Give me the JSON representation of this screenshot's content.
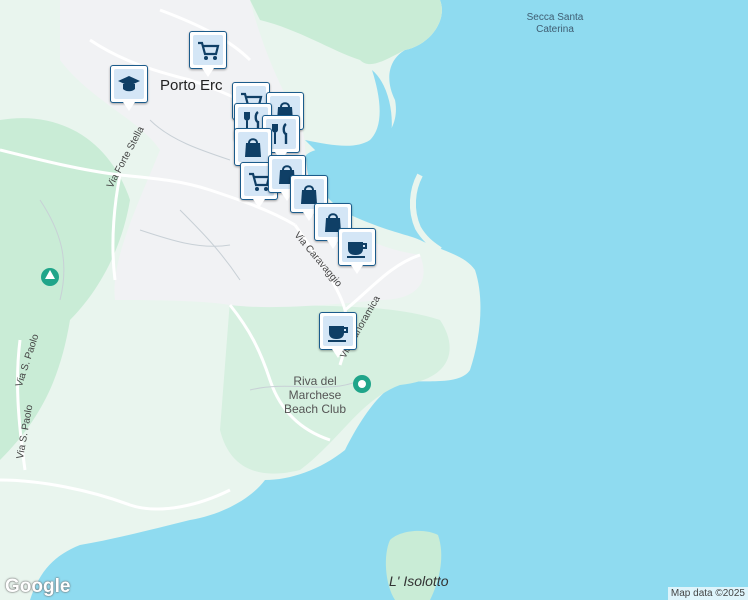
{
  "map": {
    "colors": {
      "water": "#8fdbf0",
      "land": "#e9f5ee",
      "urban": "#f1f2f4",
      "park": "#c9ecd6",
      "road": "#ffffff",
      "pin": "#d4e6f6",
      "pin_icon": "#0f3f66"
    },
    "labels": {
      "town": "Porto Erc",
      "secca": "Secca Santa Caterina",
      "beach_club": "Riva del Marchese Beach Club",
      "islet": "L' Isolotto",
      "via_caravaggio": "Via Caravaggio",
      "via_panoramica": "Via Panoramica",
      "via_forte_stella": "Via Forte Stella",
      "via_s_paolo_1": "Via S. Paolo",
      "via_s_paolo_2": "Via S. Paolo",
      "via_s_paolo_3": "Via S. Paolo"
    },
    "markers": [
      {
        "icon": "cart-icon"
      },
      {
        "icon": "school-icon"
      },
      {
        "icon": "cart-icon"
      },
      {
        "icon": "restaurant-icon"
      },
      {
        "icon": "shopping-bag-icon"
      },
      {
        "icon": "restaurant-icon"
      },
      {
        "icon": "shopping-bag-icon"
      },
      {
        "icon": "cart-icon"
      },
      {
        "icon": "shopping-bag-icon"
      },
      {
        "icon": "shopping-bag-icon"
      },
      {
        "icon": "shopping-bag-icon"
      },
      {
        "icon": "coffee-icon"
      },
      {
        "icon": "coffee-icon"
      }
    ],
    "attribution": "Map data ©2025",
    "logo": "Google"
  }
}
